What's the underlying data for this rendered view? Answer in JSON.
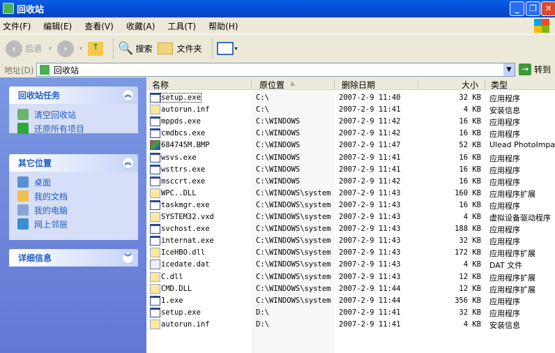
{
  "window": {
    "title": "回收站",
    "buttons": {
      "minimize": "_",
      "maximize": "❐",
      "close": "✕"
    }
  },
  "menu": [
    "文件(F)",
    "编辑(E)",
    "查看(V)",
    "收藏(A)",
    "工具(T)",
    "帮助(H)"
  ],
  "toolbar": {
    "back": "后退",
    "search": "搜索",
    "folders": "文件夹"
  },
  "address": {
    "label": "地址(D)",
    "value": "回收站",
    "go": "转到"
  },
  "tasks": {
    "title": "回收站任务",
    "items": [
      "清空回收站",
      "还原所有项目"
    ]
  },
  "places": {
    "title": "其它位置",
    "items": [
      "桌面",
      "我的文档",
      "我的电脑",
      "网上邻居"
    ]
  },
  "details": {
    "title": "详细信息"
  },
  "columns": {
    "name": "名称",
    "location": "原位置",
    "date": "删除日期",
    "size": "大小",
    "type": "类型"
  },
  "files": [
    {
      "name": "setup.exe",
      "loc": "C:\\",
      "date": "2007-2-9 11:40",
      "size": "32 KB",
      "type": "应用程序",
      "icon": "exe"
    },
    {
      "name": "autorun.inf",
      "loc": "C:\\",
      "date": "2007-2-9 11:41",
      "size": "4 KB",
      "type": "安装信息",
      "icon": "gear"
    },
    {
      "name": "mppds.exe",
      "loc": "C:\\WINDOWS",
      "date": "2007-2-9 11:42",
      "size": "16 KB",
      "type": "应用程序",
      "icon": "exe"
    },
    {
      "name": "cmdbcs.exe",
      "loc": "C:\\WINDOWS",
      "date": "2007-2-9 11:42",
      "size": "16 KB",
      "type": "应用程序",
      "icon": "exe"
    },
    {
      "name": "684745M.BMP",
      "loc": "C:\\WINDOWS",
      "date": "2007-2-9 11:47",
      "size": "52 KB",
      "type": "Ulead PhotoImpa...",
      "icon": "img"
    },
    {
      "name": "wsvs.exe",
      "loc": "C:\\WINDOWS",
      "date": "2007-2-9 11:41",
      "size": "16 KB",
      "type": "应用程序",
      "icon": "exe"
    },
    {
      "name": "wsttrs.exe",
      "loc": "C:\\WINDOWS",
      "date": "2007-2-9 11:41",
      "size": "16 KB",
      "type": "应用程序",
      "icon": "exe"
    },
    {
      "name": "msccrt.exe",
      "loc": "C:\\WINDOWS",
      "date": "2007-2-9 11:42",
      "size": "16 KB",
      "type": "应用程序",
      "icon": "exe"
    },
    {
      "name": "WPC..DLL",
      "loc": "C:\\WINDOWS\\system",
      "date": "2007-2-9 11:43",
      "size": "160 KB",
      "type": "应用程序扩展",
      "icon": "gear"
    },
    {
      "name": "taskmgr.exe",
      "loc": "C:\\WINDOWS\\system",
      "date": "2007-2-9 11:43",
      "size": "16 KB",
      "type": "应用程序",
      "icon": "exe"
    },
    {
      "name": "SYSTEM32.vxd",
      "loc": "C:\\WINDOWS\\system",
      "date": "2007-2-9 11:43",
      "size": "4 KB",
      "type": "虚拟设备驱动程序",
      "icon": "gear"
    },
    {
      "name": "svchost.exe",
      "loc": "C:\\WINDOWS\\system",
      "date": "2007-2-9 11:43",
      "size": "188 KB",
      "type": "应用程序",
      "icon": "exe"
    },
    {
      "name": "internat.exe",
      "loc": "C:\\WINDOWS\\system",
      "date": "2007-2-9 11:43",
      "size": "32 KB",
      "type": "应用程序",
      "icon": "exe"
    },
    {
      "name": "IceHBO.dll",
      "loc": "C:\\WINDOWS\\system",
      "date": "2007-2-9 11:43",
      "size": "172 KB",
      "type": "应用程序扩展",
      "icon": "gear"
    },
    {
      "name": "icedate.dat",
      "loc": "C:\\WINDOWS\\system",
      "date": "2007-2-9 11:43",
      "size": "4 KB",
      "type": "DAT 文件",
      "icon": "dat"
    },
    {
      "name": "C.dll",
      "loc": "C:\\WINDOWS\\system",
      "date": "2007-2-9 11:43",
      "size": "12 KB",
      "type": "应用程序扩展",
      "icon": "gear"
    },
    {
      "name": "CMD.DLL",
      "loc": "C:\\WINDOWS\\system",
      "date": "2007-2-9 11:44",
      "size": "12 KB",
      "type": "应用程序扩展",
      "icon": "gear"
    },
    {
      "name": "1.exe",
      "loc": "C:\\WINDOWS\\system",
      "date": "2007-2-9 11:44",
      "size": "356 KB",
      "type": "应用程序",
      "icon": "exe"
    },
    {
      "name": "setup.exe",
      "loc": "D:\\",
      "date": "2007-2-9 11:41",
      "size": "32 KB",
      "type": "应用程序",
      "icon": "exe"
    },
    {
      "name": "autorun.inf",
      "loc": "D:\\",
      "date": "2007-2-9 11:41",
      "size": "4 KB",
      "type": "安装信息",
      "icon": "gear"
    }
  ]
}
